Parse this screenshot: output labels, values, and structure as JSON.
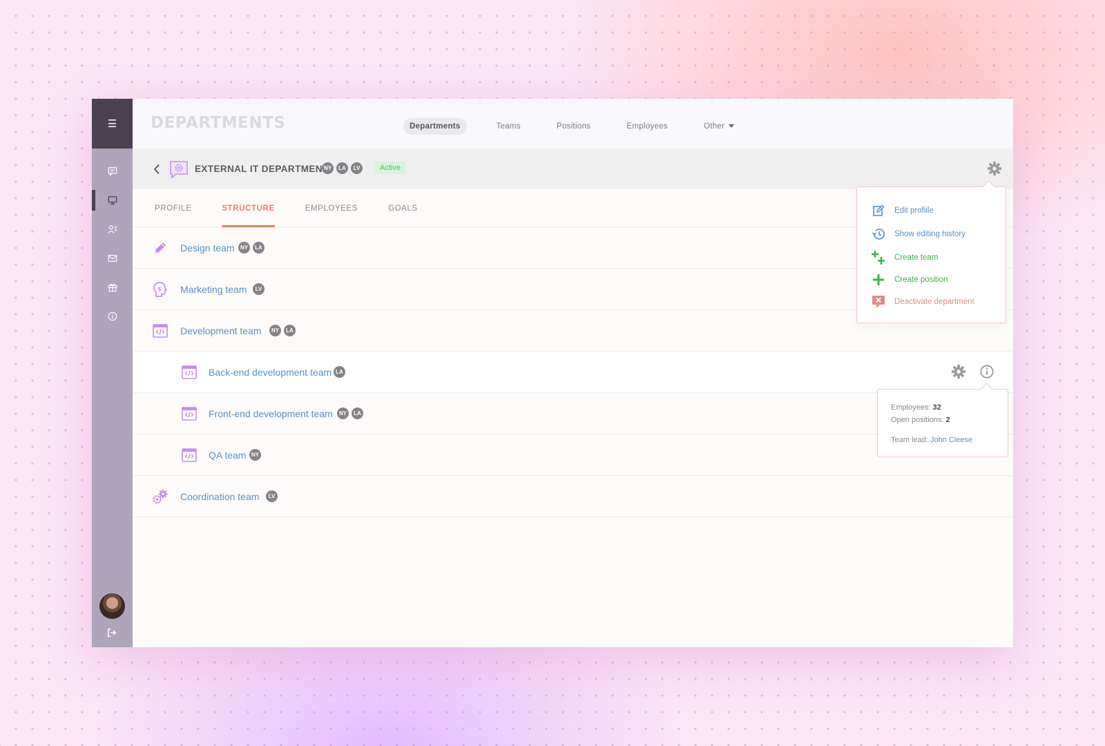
{
  "app": {
    "page_title": "DEPARTMENTS"
  },
  "top_nav": [
    {
      "label": "Departments",
      "active": true
    },
    {
      "label": "Teams"
    },
    {
      "label": "Positions"
    },
    {
      "label": "Employees"
    },
    {
      "label": "Other",
      "has_dropdown": true
    }
  ],
  "sidebar": {
    "menu_icon": "hamburger-icon",
    "items": [
      {
        "icon": "chat-icon"
      },
      {
        "icon": "monitor-icon",
        "active": true
      },
      {
        "icon": "user-list-icon"
      },
      {
        "icon": "mail-icon"
      },
      {
        "icon": "gift-icon"
      },
      {
        "icon": "info-icon"
      }
    ],
    "logout_icon": "logout-icon"
  },
  "department": {
    "name": "EXTERNAL IT DEPARTMENT",
    "badges": [
      "NY",
      "LA",
      "LV"
    ],
    "status": "Active"
  },
  "tabs": [
    {
      "label": "PROFILE"
    },
    {
      "label": "STRUCTURE",
      "active": true
    },
    {
      "label": "EMPLOYEES"
    },
    {
      "label": "GOALS"
    }
  ],
  "teams": {
    "design": {
      "name": "Design team",
      "badges": [
        "NY",
        "LA"
      ],
      "icon": "pencil-icon"
    },
    "marketing": {
      "name": "Marketing team",
      "badges": [
        "LV"
      ],
      "icon": "money-head-icon"
    },
    "development": {
      "name": "Development team",
      "badges": [
        "NY",
        "LA"
      ],
      "icon": "code-window-icon"
    },
    "backend": {
      "name": "Back-end development team",
      "badges": [
        "LA"
      ],
      "icon": "code-window-icon"
    },
    "frontend": {
      "name": "Front-end development team",
      "badges": [
        "NY",
        "LA"
      ],
      "icon": "code-window-icon"
    },
    "qa": {
      "name": "QA team",
      "badges": [
        "NY"
      ],
      "icon": "code-window-icon"
    },
    "coordination": {
      "name": "Coordination team",
      "badges": [
        "LV"
      ],
      "icon": "gears-icon"
    }
  },
  "dropdown_menu": {
    "edit_profile": "Edit profiile",
    "show_history": "Show editing history",
    "create_team": "Create team",
    "create_position": "Create position",
    "deactivate": "Deactivate department"
  },
  "info_popup": {
    "employees_label": "Employees:",
    "employees_value": "32",
    "open_positions_label": "Open positions:",
    "open_positions_value": "2",
    "team_lead_label": "Team lead:",
    "team_lead_value": "John Cleese"
  },
  "colors": {
    "accent": "#f07d60",
    "link": "#5a8fc6",
    "icon_purple": "#c48cf0",
    "sidebar": "#aea4bc",
    "sidebar_dark": "#4a4250",
    "success": "#3cb14a",
    "danger": "#e28a86"
  }
}
